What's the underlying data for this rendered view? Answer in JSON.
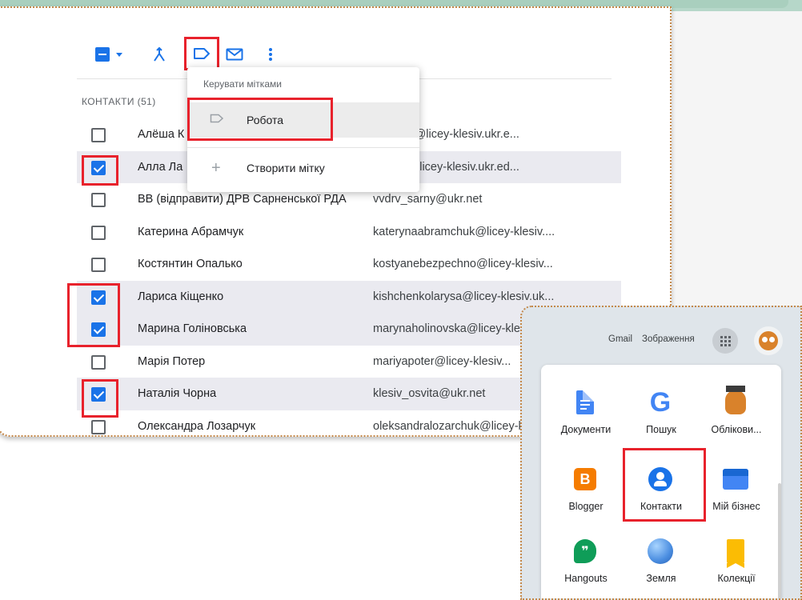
{
  "apps_header": {
    "gmail": "Gmail",
    "images": "Зображення"
  },
  "menu": {
    "title": "Керувати мітками",
    "items": [
      {
        "icon": "label-outline-icon",
        "label": "Робота"
      },
      {
        "icon": "plus-icon",
        "label": "Створити мітку"
      }
    ]
  },
  "contacts": {
    "section_title": "КОНТАКТИ (51)",
    "rows": [
      {
        "name": "Алёша К",
        "email": "vkorpan@licey-klesiv.ukr.e...",
        "checked": false
      },
      {
        "name": "Алла Ла",
        "email": "archuk@licey-klesiv.ukr.ed...",
        "checked": true
      },
      {
        "name": "ВВ (відправити) ДРВ Сарненської РДА",
        "email": "vvdrv_sarny@ukr.net",
        "checked": false
      },
      {
        "name": "Катерина Абрамчук",
        "email": "katerynaabramchuk@licey-klesiv....",
        "checked": false
      },
      {
        "name": "Костянтин Опалько",
        "email": "kostyanebezpechno@licey-klesiv...",
        "checked": false
      },
      {
        "name": "Лариса Кіщенко",
        "email": "kishchenkolarysa@licey-klesiv.uk...",
        "checked": true
      },
      {
        "name": "Марина Голіновська",
        "email": "marynaholinovska@licey-klesiv...",
        "checked": true
      },
      {
        "name": "Марія Потер",
        "email": "mariyapoter@licey-klesiv...",
        "checked": false
      },
      {
        "name": "Наталія Чорна",
        "email": "klesiv_osvita@ukr.net",
        "checked": true
      },
      {
        "name": "Олександра Лозарчук",
        "email": "oleksandralozarchuk@licey-klesiv...",
        "checked": false
      }
    ]
  },
  "apps": [
    {
      "label": "Документи",
      "icon": "google-docs-icon"
    },
    {
      "label": "Пошук",
      "icon": "google-search-icon"
    },
    {
      "label": "Облікови...",
      "icon": "account-owl-icon"
    },
    {
      "label": "Blogger",
      "icon": "blogger-icon"
    },
    {
      "label": "Контакти",
      "icon": "contacts-icon"
    },
    {
      "label": "Мій бізнес",
      "icon": "my-business-icon"
    },
    {
      "label": "Hangouts",
      "icon": "hangouts-icon"
    },
    {
      "label": "Земля",
      "icon": "earth-icon"
    },
    {
      "label": "Колекції",
      "icon": "collections-icon"
    }
  ],
  "colors": {
    "accent": "#1a73e8",
    "highlight": "#e8222c",
    "frame": "#c4884a",
    "top_band": "#a9cfbe"
  }
}
